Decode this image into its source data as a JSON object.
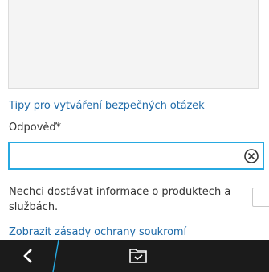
{
  "security_question_area": {
    "value": ""
  },
  "tips_link": {
    "label": "Tipy pro vytváření bezpečných otázek"
  },
  "answer": {
    "label": "Odpověď*",
    "value": "",
    "placeholder": ""
  },
  "marketing_optout": {
    "label": "Nechci dostávat informace o produktech a službách.",
    "checked": false
  },
  "privacy_link": {
    "label": "Zobrazit zásady ochrany soukromí"
  },
  "bottom_bar": {
    "back_icon": "chevron-left-icon",
    "action_icon": "folder-check-icon"
  },
  "colors": {
    "link": "#1e6aa8",
    "input_focus_border": "#27a9e1",
    "bottom_bar": "#1b1b1b",
    "accent_line": "#27a9e1"
  }
}
